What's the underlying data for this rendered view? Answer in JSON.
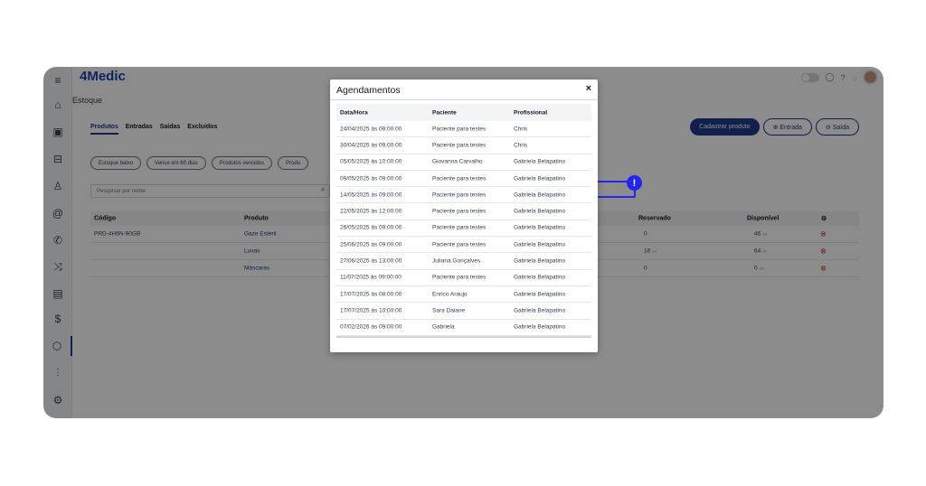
{
  "app": {
    "logo": "4Medic"
  },
  "sidebar": {
    "items": [
      {
        "icon": "menu-icon",
        "glyph": "≡"
      },
      {
        "icon": "home-icon",
        "glyph": "⌂"
      },
      {
        "icon": "calendar-icon",
        "glyph": "▣"
      },
      {
        "icon": "inbox-icon",
        "glyph": "⊟"
      },
      {
        "icon": "user-icon",
        "glyph": "♙"
      },
      {
        "icon": "at-icon",
        "glyph": "@"
      },
      {
        "icon": "phone-icon",
        "glyph": "✆"
      },
      {
        "icon": "shuffle-icon",
        "glyph": "⤨"
      },
      {
        "icon": "clipboard-icon",
        "glyph": "▤"
      },
      {
        "icon": "dollar-icon",
        "glyph": "$"
      },
      {
        "icon": "box-icon",
        "glyph": "⬡"
      },
      {
        "icon": "chart-icon",
        "glyph": "⫶"
      },
      {
        "icon": "settings-icon",
        "glyph": "⚙"
      }
    ]
  },
  "breadcrumb": "Estoque",
  "tabs": [
    "Produtos",
    "Entradas",
    "Saídas",
    "Excluídos"
  ],
  "actions": {
    "primary": "Cadastrar produto",
    "entrada": "⊕ Entrada",
    "saida": "⊖ Saída"
  },
  "filters": [
    "Estoque baixo",
    "Vence em 60 dias",
    "Produtos vencidos",
    "Produ"
  ],
  "search": {
    "placeholder": "Pesquisar por nome"
  },
  "table": {
    "headers": {
      "codigo": "Código",
      "produto": "Produto",
      "reservado": "Reservado",
      "disponivel": "Disponível"
    },
    "rows": [
      {
        "codigo": "PRD-4H6N-90GB",
        "produto": "Gaze Estéril",
        "reservado": "0",
        "reservado_unit": "",
        "disponivel": "46",
        "disponivel_unit": "un"
      },
      {
        "codigo": "",
        "produto": "Luvas",
        "reservado": "16",
        "reservado_unit": "un",
        "disponivel": "64",
        "disponivel_unit": "un"
      },
      {
        "codigo": "",
        "produto": "Máscaras",
        "reservado": "0",
        "reservado_unit": "",
        "disponivel": "0",
        "disponivel_unit": "un"
      }
    ]
  },
  "modal": {
    "title": "Agendamentos",
    "close": "×",
    "headers": [
      "Data/Hora",
      "Paciente",
      "Profissional"
    ],
    "rows": [
      [
        "24/04/2025 às 08:00:00",
        "Paciente para testes",
        "Chris"
      ],
      [
        "30/04/2025 às 09:00:00",
        "Paciente para testes",
        "Chris"
      ],
      [
        "05/05/2025 às 10:00:00",
        "Giovanna Carvalho",
        "Gabriela Belapatino"
      ],
      [
        "09/05/2025 às 09:00:00",
        "Paciente para testes",
        "Gabriela Belapatino"
      ],
      [
        "14/05/2025 às 09:00:00",
        "Paciente para testes",
        "Gabriela Belapatino"
      ],
      [
        "22/05/2025 às 12:00:00",
        "Paciente para testes",
        "Gabriela Belapatino"
      ],
      [
        "26/05/2025 às 09:00:00",
        "Paciente para testes",
        "Gabriela Belapatino"
      ],
      [
        "25/06/2025 às 09:00:00",
        "Paciente para testes",
        "Gabriela Belapatino"
      ],
      [
        "27/06/2025 às 13:00:00",
        "Juliana Gonçalves",
        "Gabriela Belapatino"
      ],
      [
        "11/07/2025 às 09:00:00",
        "Paciente para testes",
        "Gabriela Belapatino"
      ],
      [
        "17/07/2025 às 08:00:00",
        "Enrico Araujo",
        "Gabriela Belapatino"
      ],
      [
        "17/07/2025 às 10:00:00",
        "Sara Daiane",
        "Gabriela Belapatino"
      ],
      [
        "07/02/2026 às 09:00:00",
        "Gabriela",
        "Gabriela Belapatino"
      ]
    ]
  },
  "highlight": {
    "badge": "!"
  },
  "colors": {
    "brand": "#1e3a8a",
    "highlight": "#2424f0",
    "danger": "#dc2626"
  }
}
